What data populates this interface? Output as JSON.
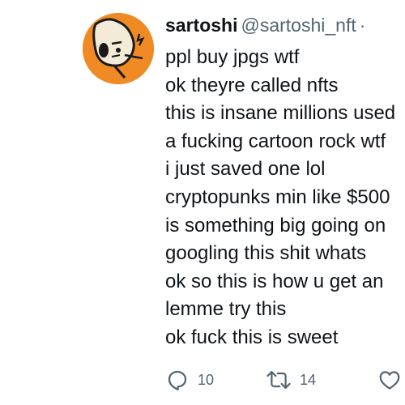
{
  "tweet": {
    "display_name": "sartoshi",
    "handle": "@sartoshi_nft",
    "separator": "·",
    "lines": [
      "ppl buy jpgs wtf",
      "ok theyre called nfts",
      "this is insane millions used",
      "a fucking cartoon rock wtf",
      "i just saved one lol",
      "cryptopunks min like $500",
      "is something big going on",
      "googling this shit whats",
      "ok so this is how u get an",
      "lemme try this",
      "ok fuck this is sweet"
    ],
    "actions": {
      "reply_count": "10",
      "retweet_count": "14"
    }
  },
  "icons": {
    "reply": "reply-bubble-icon",
    "retweet": "retweet-arrows-icon",
    "like": "heart-icon"
  },
  "colors": {
    "avatar_bg": "#f08a24",
    "text": "#0f1419",
    "muted": "#536471"
  }
}
